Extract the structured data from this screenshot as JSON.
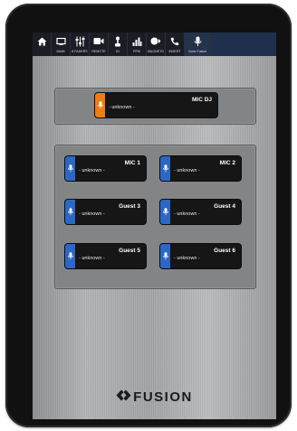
{
  "tabs": [
    {
      "name": "home",
      "label": "",
      "icon": "home-icon"
    },
    {
      "name": "main",
      "label": "MAIN",
      "icon": "monitor-icon"
    },
    {
      "name": "faders",
      "label": "8 FADERS",
      "icon": "faders-icon"
    },
    {
      "name": "remote",
      "label": "REMOTE",
      "icon": "video-camera-icon"
    },
    {
      "name": "io",
      "label": "IO",
      "icon": "usb-icon"
    },
    {
      "name": "ppm",
      "label": "PPM",
      "icon": "meter-bars-icon"
    },
    {
      "name": "magneto",
      "label": "MAGNETO",
      "icon": "magneto-icon"
    },
    {
      "name": "insert",
      "label": "INSERT",
      "icon": "phone-icon"
    },
    {
      "name": "voice-fusion",
      "label": "Voice Fusion",
      "icon": "microphone-icon"
    }
  ],
  "dj_channel": {
    "name": "MIC DJ",
    "status": "- unknown -",
    "color": "#f07d11"
  },
  "channels": [
    {
      "name": "MIC 1",
      "status": "- unknown -"
    },
    {
      "name": "MIC 2",
      "status": "- unknown -"
    },
    {
      "name": "Guest 3",
      "status": "- unknown -"
    },
    {
      "name": "Guest 4",
      "status": "- unknown -"
    },
    {
      "name": "Guest 5",
      "status": "- unknown -"
    },
    {
      "name": "Guest 6",
      "status": "- unknown -"
    }
  ],
  "channel_color": "#2d67c6",
  "brand": {
    "name": "FUSION"
  }
}
